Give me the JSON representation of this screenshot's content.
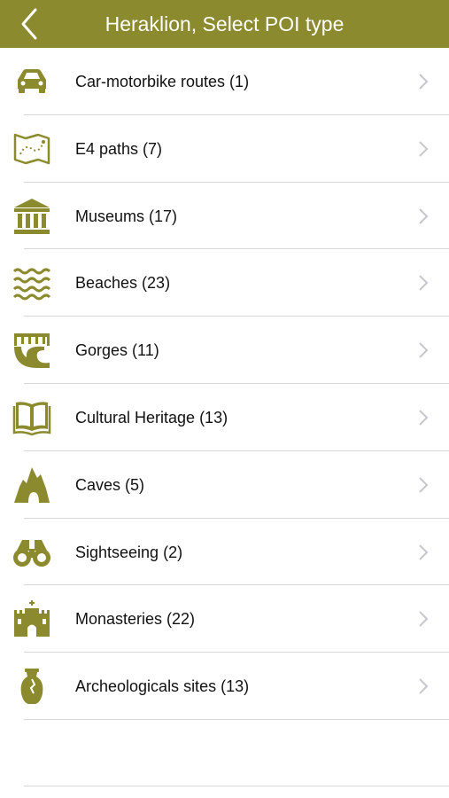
{
  "header": {
    "title": "Heraklion, Select POI type",
    "back_icon": "chevron-left-icon"
  },
  "colors": {
    "accent": "#8c8a2e",
    "header_text": "#ffffff",
    "chevron": "#c7c7cc",
    "separator": "#d8d8d8"
  },
  "items": [
    {
      "label": "Car-motorbike routes (1)",
      "icon": "car-icon"
    },
    {
      "label": "E4 paths (7)",
      "icon": "map-icon"
    },
    {
      "label": "Museums (17)",
      "icon": "museum-icon"
    },
    {
      "label": "Beaches (23)",
      "icon": "waves-icon"
    },
    {
      "label": "Gorges (11)",
      "icon": "gorge-icon"
    },
    {
      "label": "Cultural Heritage (13)",
      "icon": "book-icon"
    },
    {
      "label": "Caves (5)",
      "icon": "cave-icon"
    },
    {
      "label": "Sightseeing (2)",
      "icon": "binoculars-icon"
    },
    {
      "label": "Monasteries (22)",
      "icon": "monastery-icon"
    },
    {
      "label": "Archeologicals sites (13)",
      "icon": "amphora-icon"
    }
  ]
}
